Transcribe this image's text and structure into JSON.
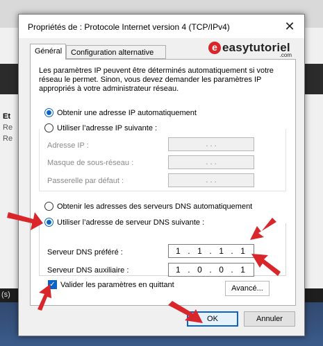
{
  "background": {
    "left_texts": [
      "Et",
      "Re",
      "Re"
    ],
    "status_text": "(s)"
  },
  "dialog": {
    "title": "Propriétés de : Protocole Internet version 4 (TCP/IPv4)",
    "close_glyph": "✕"
  },
  "tabs": [
    {
      "label": "Général"
    },
    {
      "label": "Configuration alternative"
    }
  ],
  "logo": {
    "text": "easytutoriel",
    "suffix": ".com",
    "mark": "e"
  },
  "intro_text": "Les paramètres IP peuvent être déterminés automatiquement si votre réseau le permet. Sinon, vous devez demander les paramètres IP appropriés à votre administrateur réseau.",
  "ip_section": {
    "auto_label": "Obtenir une adresse IP automatiquement",
    "manual_label": "Utiliser l’adresse IP suivante :",
    "fields": [
      {
        "label": "Adresse IP :",
        "value": ".   .   ."
      },
      {
        "label": "Masque de sous-réseau :",
        "value": ".   .   ."
      },
      {
        "label": "Passerelle par défaut :",
        "value": ".   .   ."
      }
    ]
  },
  "dns_section": {
    "auto_label": "Obtenir les adresses des serveurs DNS automatiquement",
    "manual_label": "Utiliser l’adresse de serveur DNS suivante :",
    "preferred": {
      "label": "Serveur DNS préféré :",
      "octets": [
        "1",
        "1",
        "1",
        "1"
      ]
    },
    "alternate": {
      "label": "Serveur DNS auxiliaire :",
      "octets": [
        "1",
        "0",
        "0",
        "1"
      ]
    }
  },
  "validate_label": "Valider les paramètres en quittant",
  "buttons": {
    "advanced": "Avancé...",
    "ok": "OK",
    "cancel": "Annuler"
  },
  "colors": {
    "accent": "#0a64c8",
    "arrow": "#d8262b"
  }
}
